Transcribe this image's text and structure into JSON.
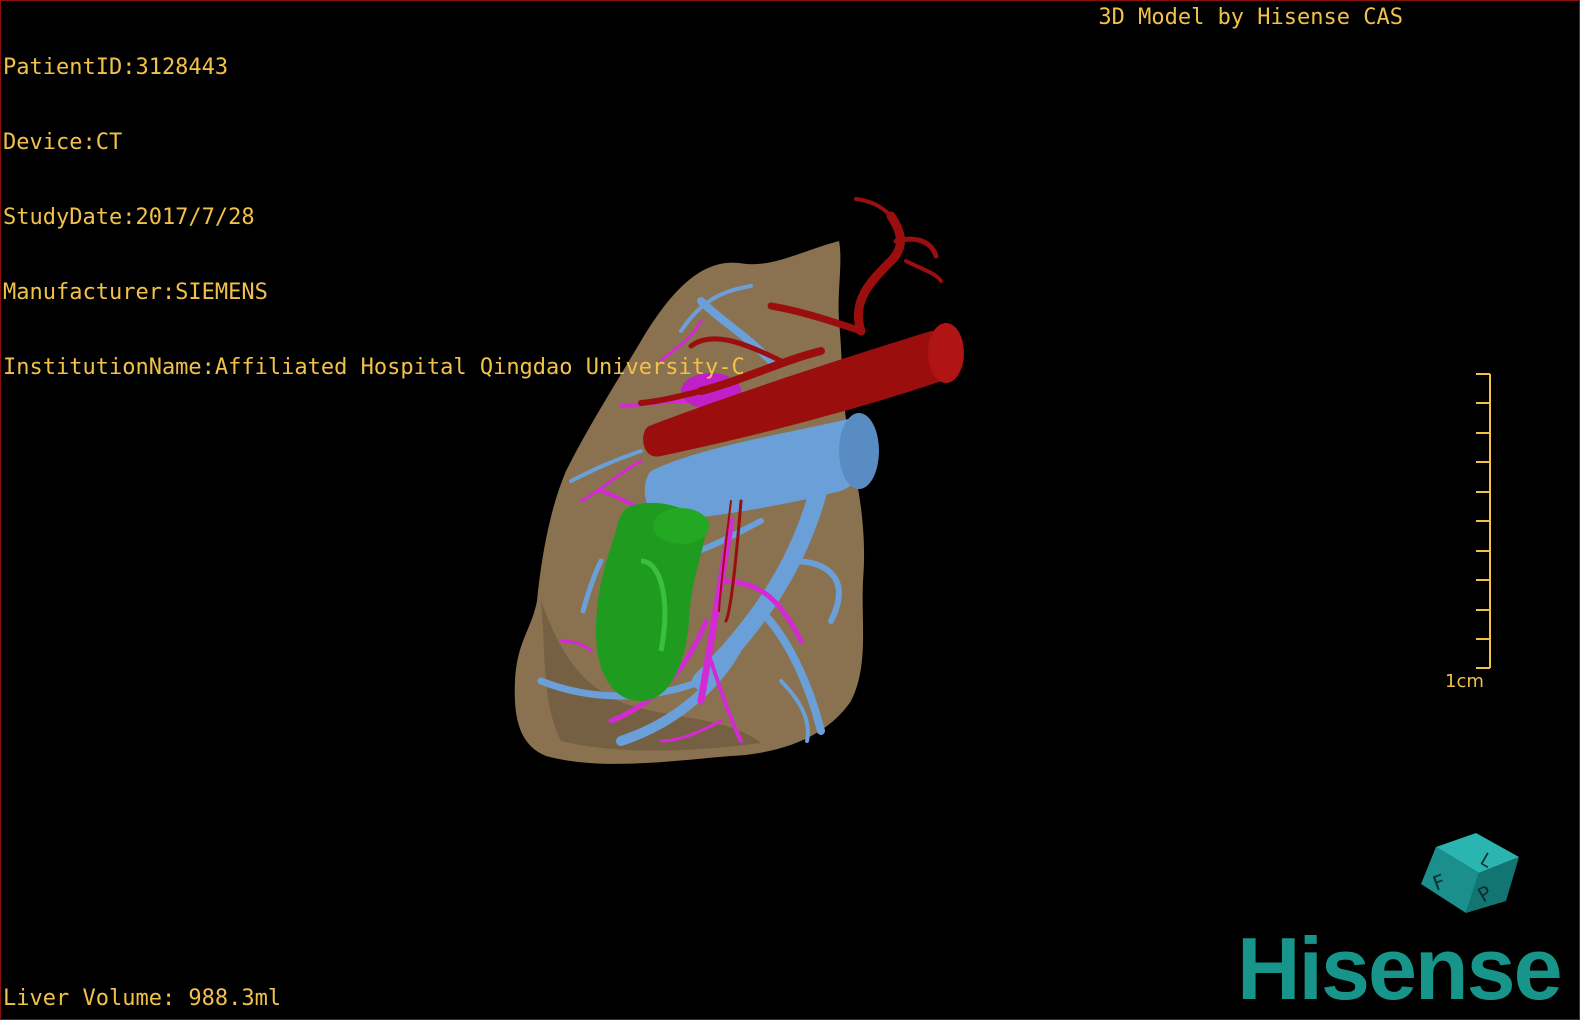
{
  "header": {
    "patient_id": "PatientID:3128443",
    "device": "Device:CT",
    "study_date": "StudyDate:2017/7/28",
    "manufacturer": "Manufacturer:SIEMENS",
    "institution": "InstitutionName:Affiliated Hospital Qingdao University-C"
  },
  "watermark_title": "3D Model by Hisense CAS",
  "scale_bar": {
    "label": "1cm"
  },
  "liver_volume": "Liver Volume: 988.3ml",
  "orientation_cube": {
    "labels": [
      "F",
      "L",
      "P"
    ],
    "color": "#1a8f8c"
  },
  "logo": {
    "text": "Hisense",
    "color": "#18958a"
  },
  "colors": {
    "text": "#f2c14a",
    "liver": "#8a7150",
    "artery": "#9a0e0e",
    "portal_vein": "#6a9fd8",
    "hepatic_vein": "#d42ad4",
    "tumor": "#1f9c1f",
    "border": "#8a1010"
  },
  "icons": [
    "orientation-cube-icon",
    "scale-bar-icon",
    "hisense-logo"
  ]
}
